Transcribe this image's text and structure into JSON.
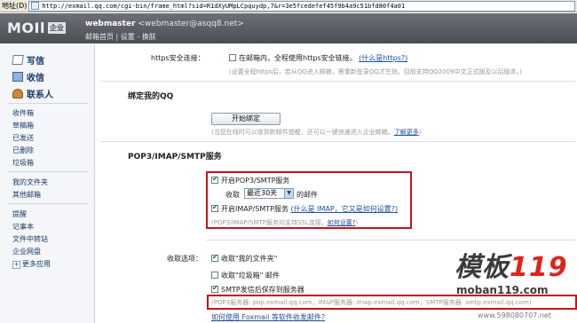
{
  "addressbar": {
    "label": "地址(D)",
    "url": "http://exmail.qq.com/cgi-bin/frame_html?sid=R1dXyUMpLCpquydp,7&r=3e5fcedefef45f9b4a9c51bfd80f4a01"
  },
  "header": {
    "logo_text": "MOIl",
    "logo_badge": "企业",
    "account_name": "webmaster",
    "account_email": "<webmaster@asqq8.net>",
    "links": "邮箱首页 | 设置 - 换肤"
  },
  "sidebar": {
    "primary": [
      {
        "label": "写信",
        "icon": "compose-icon"
      },
      {
        "label": "收信",
        "icon": "inbox-icon"
      },
      {
        "label": "联系人",
        "icon": "contacts-icon"
      }
    ],
    "folders": [
      "收件箱",
      "草稿箱",
      "已发送",
      "已删除",
      "垃圾箱"
    ],
    "my_folders": [
      "我的文件夹",
      "其他邮箱"
    ],
    "tools": [
      "提醒",
      "记事本",
      "文件中转站",
      "企业网盘",
      "更多应用"
    ]
  },
  "main": {
    "https_label": "https安全连接：",
    "https_option": "在邮箱内，全程使用https安全链接。",
    "https_help_link": "(什么是https?)",
    "https_note": "(设置全程https后，若从QQ进入邮箱，需重新登录QQ才生效。目前支持QQ2009中文正式版及以后版本。)",
    "bind_qq_heading": "绑定我的QQ",
    "bind_button": "开始绑定",
    "bind_note": "(当您在线时可以收到新邮件提醒，还可以一键快速进入企业邮箱。",
    "bind_link": "了解更多",
    "bind_note_end": ")",
    "pop_heading": "POP3/IMAP/SMTP服务",
    "pop_option": "开启POP3/SMTP服务",
    "receive_label": "收取",
    "receive_range": "最近30天",
    "receive_suffix": "的邮件",
    "imap_option": "开启IMAP/SMTP服务",
    "imap_help_link": "(什么是 IMAP，它又是如何设置?)",
    "ssl_note": "(POP3/IMAP/SMTP服务均支持SSL连接。",
    "ssl_link": "如何设置?",
    "ssl_note_end": ")",
    "receive_options_label": "收取选项：",
    "opt_my_folders": "收取\"我的文件夹\"",
    "opt_junk": "收取\"垃圾箱\" 邮件",
    "opt_save_sent": "SMTP发信后保存到服务器",
    "server_note": "(POP3服务器: pop.exmail.qq.com，IMAP服务器: imap.exmail.qq.com，SMTP服务器: smtp.exmail.qq.com)",
    "foxmail_link": "如何使用 Foxmail 等软件收发邮件?"
  },
  "watermark": {
    "main_text": "模板",
    "number": "119",
    "site": "moban119.com",
    "url": "www.598080707.net"
  }
}
